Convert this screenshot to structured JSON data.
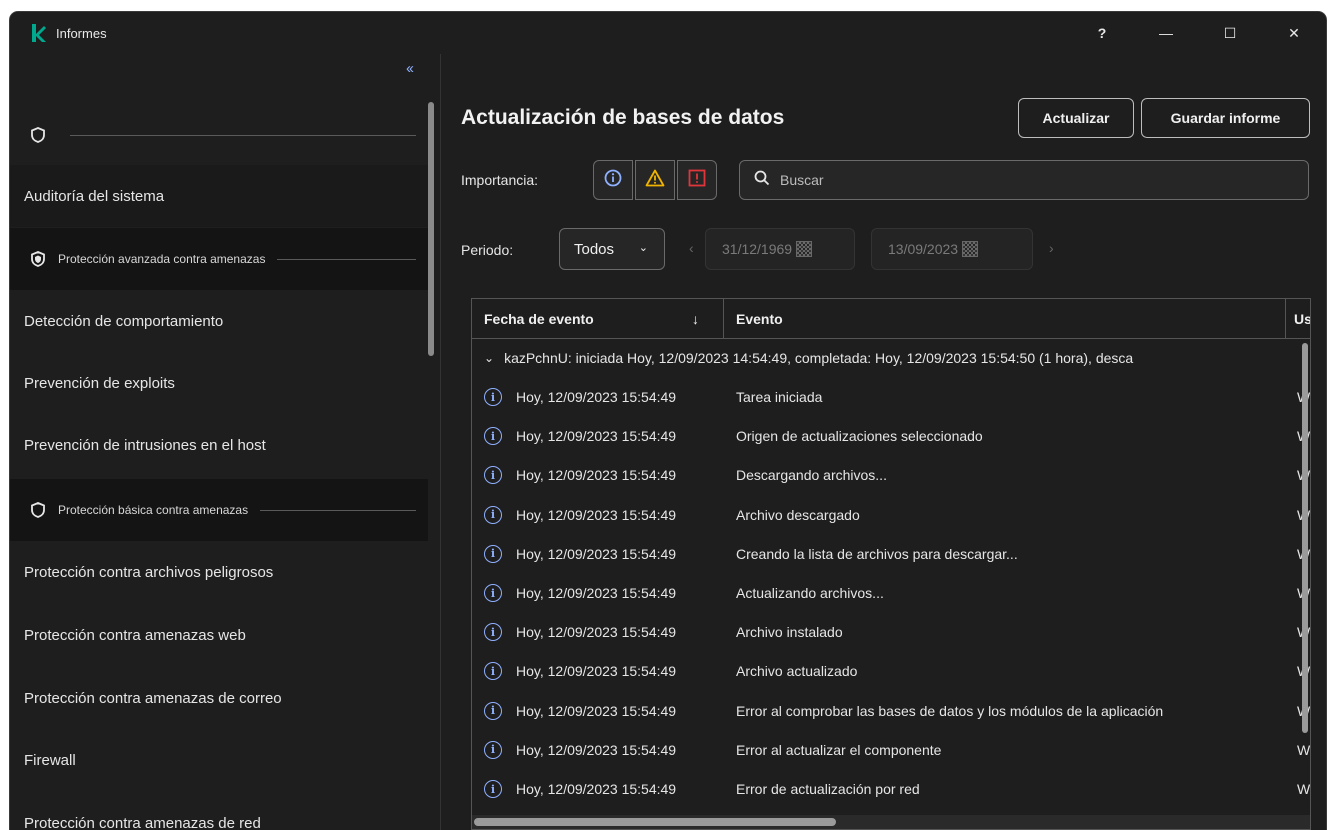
{
  "window": {
    "title": "Informes",
    "help": "?",
    "minimize": "—",
    "maximize": "☐",
    "close": "✕"
  },
  "sidebar": {
    "collapse": "‹‹",
    "sections": [
      {
        "label": ""
      },
      {
        "label": "Protección avanzada contra amenazas"
      },
      {
        "label": "Protección básica contra amenazas"
      }
    ],
    "items": [
      {
        "label": "Auditoría del sistema"
      },
      {
        "label": "Detección de comportamiento"
      },
      {
        "label": "Prevención de exploits"
      },
      {
        "label": "Prevención de intrusiones en el host"
      },
      {
        "label": "Protección contra archivos peligrosos"
      },
      {
        "label": "Protección contra amenazas web"
      },
      {
        "label": "Protección contra amenazas de correo"
      },
      {
        "label": "Firewall"
      },
      {
        "label": "Protección contra amenazas de red"
      }
    ]
  },
  "main": {
    "title": "Actualización de bases de datos",
    "refresh_label": "Actualizar",
    "save_label": "Guardar informe",
    "importance_label": "Importancia:",
    "search_placeholder": "Buscar",
    "period_label": "Periodo:",
    "period_value": "Todos",
    "date_from": "31/12/1969",
    "date_to": "13/09/2023",
    "table": {
      "columns": [
        "Fecha de evento",
        "Evento",
        "Us"
      ],
      "sort_indicator": "↓",
      "group_row": "kazPchnU: iniciada Hoy, 12/09/2023 14:54:49, completada: Hoy, 12/09/2023 15:54:50 (1 hora), desca",
      "rows": [
        {
          "date": "Hoy, 12/09/2023 15:54:49",
          "event": "Tarea iniciada",
          "user": "W"
        },
        {
          "date": "Hoy, 12/09/2023 15:54:49",
          "event": "Origen de actualizaciones seleccionado",
          "user": "W"
        },
        {
          "date": "Hoy, 12/09/2023 15:54:49",
          "event": "Descargando archivos...",
          "user": "W"
        },
        {
          "date": "Hoy, 12/09/2023 15:54:49",
          "event": "Archivo descargado",
          "user": "W"
        },
        {
          "date": "Hoy, 12/09/2023 15:54:49",
          "event": "Creando la lista de archivos para descargar...",
          "user": "W"
        },
        {
          "date": "Hoy, 12/09/2023 15:54:49",
          "event": "Actualizando archivos...",
          "user": "W"
        },
        {
          "date": "Hoy, 12/09/2023 15:54:49",
          "event": "Archivo instalado",
          "user": "W"
        },
        {
          "date": "Hoy, 12/09/2023 15:54:49",
          "event": "Archivo actualizado",
          "user": "W"
        },
        {
          "date": "Hoy, 12/09/2023 15:54:49",
          "event": "Error al comprobar las bases de datos y los módulos de la aplicación",
          "user": "W"
        },
        {
          "date": "Hoy, 12/09/2023 15:54:49",
          "event": "Error al actualizar el componente",
          "user": "W"
        },
        {
          "date": "Hoy, 12/09/2023 15:54:49",
          "event": "Error de actualización por red",
          "user": "W"
        }
      ]
    }
  },
  "icons": {
    "info": "info-icon",
    "warning": "warning-icon",
    "critical": "critical-icon",
    "search": "search-icon",
    "calendar": "calendar-icon",
    "shield": "shield-icon"
  },
  "colors": {
    "background": "#1e1e1e",
    "sidebar_alt": "#141414",
    "accent_blue": "#8fb0ff",
    "warning": "#f0b400",
    "critical": "#e0353a",
    "logo": "#00a88e"
  }
}
